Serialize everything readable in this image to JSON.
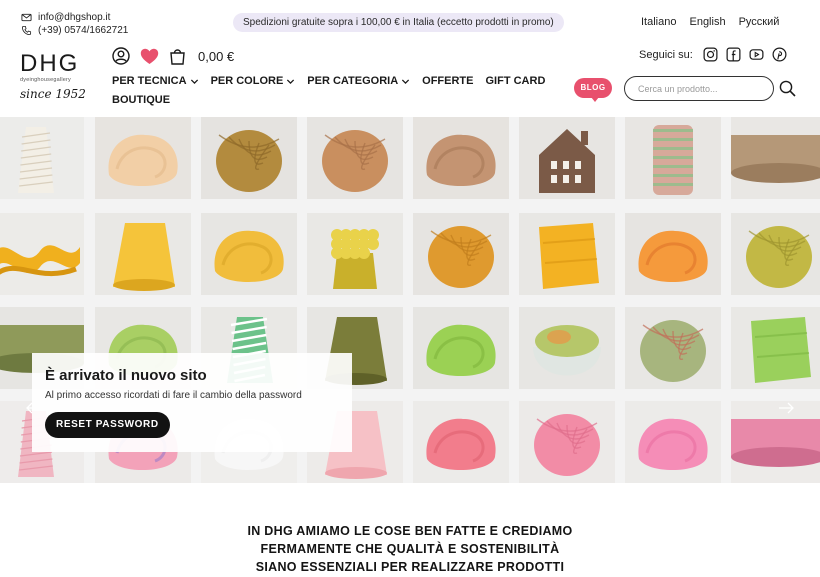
{
  "topbar": {
    "email": "info@dhgshop.it",
    "phone": "(+39) 0574/1662721",
    "promo": "Spedizioni gratuite sopra i 100,00 € in Italia (eccetto prodotti in promo)",
    "languages": [
      "Italiano",
      "English",
      "Русский"
    ]
  },
  "header": {
    "logo_main": "DHG",
    "logo_sub": "dyeinghousegallery",
    "logo_since": "since 1952",
    "cart_total": "0,00 €",
    "social_label": "Seguici su:",
    "search_placeholder": "Cerca un prodotto...",
    "blog_label": "BLOG",
    "social_icons": [
      "instagram-icon",
      "facebook-icon",
      "youtube-icon",
      "pinterest-icon"
    ]
  },
  "nav": {
    "items": [
      {
        "label": "PER TECNICA",
        "dropdown": true
      },
      {
        "label": "PER COLORE",
        "dropdown": true
      },
      {
        "label": "PER CATEGORIA",
        "dropdown": true
      },
      {
        "label": "OFFERTE",
        "dropdown": false
      },
      {
        "label": "GIFT CARD",
        "dropdown": false
      },
      {
        "label": "BOUTIQUE",
        "dropdown": false
      }
    ]
  },
  "hero": {
    "tiles": [
      {
        "bg": "#ececea",
        "color": "#f3efe6",
        "accent": "#d9cfbd",
        "shape": "cone"
      },
      {
        "bg": "#e7e4e0",
        "color": "#f2cfa6",
        "accent": "#e3b98b",
        "shape": "fleece"
      },
      {
        "bg": "#e5e3e0",
        "color": "#b38b3e",
        "accent": "#8e6a2a",
        "shape": "ball"
      },
      {
        "bg": "#e6e4e1",
        "color": "#c98f5f",
        "accent": "#a87148",
        "shape": "ball"
      },
      {
        "bg": "#e6e3df",
        "color": "#c49472",
        "accent": "#a77856",
        "shape": "fleece"
      },
      {
        "bg": "#e7e5e2",
        "color": "#7b5a47",
        "accent": "#5f4434",
        "shape": "house"
      },
      {
        "bg": "#e8e6e3",
        "color": "#d7a99a",
        "accent": "#8fbf8a",
        "shape": "spool"
      },
      {
        "bg": "#e9e7e4",
        "color": "#b59878",
        "accent": "#9b7d5e",
        "shape": "roll"
      },
      {
        "bg": "#ecebe8",
        "color": "#f0b01e",
        "accent": "#d79510",
        "shape": "ribbon"
      },
      {
        "bg": "#e9e8e5",
        "color": "#f5c43a",
        "accent": "#dca61f",
        "shape": "felt"
      },
      {
        "bg": "#e7e6e3",
        "color": "#f1bd3c",
        "accent": "#d9a325",
        "shape": "fleece"
      },
      {
        "bg": "#e9e8e5",
        "color": "#e9d24a",
        "accent": "#c9b02b",
        "shape": "boucle"
      },
      {
        "bg": "#e6e4e1",
        "color": "#df9a2f",
        "accent": "#c07d1d",
        "shape": "ball"
      },
      {
        "bg": "#e8e7e4",
        "color": "#f3b223",
        "accent": "#d99512",
        "shape": "cloth"
      },
      {
        "bg": "#e6e4e1",
        "color": "#f59a3c",
        "accent": "#e0742a",
        "shape": "fleece"
      },
      {
        "bg": "#e7e6e3",
        "color": "#c2b845",
        "accent": "#9e942f",
        "shape": "ball"
      },
      {
        "bg": "#e6e5e2",
        "color": "#8f9a5a",
        "accent": "#6e7a40",
        "shape": "roll"
      },
      {
        "bg": "#e8e7e4",
        "color": "#a9cf64",
        "accent": "#8bb44c",
        "shape": "fleece"
      },
      {
        "bg": "#e9e8e5",
        "color": "#6cc28a",
        "accent": "#ffffff",
        "shape": "stripe"
      },
      {
        "bg": "#e7e6e3",
        "color": "#7b7d3a",
        "accent": "#5f6128",
        "shape": "felt"
      },
      {
        "bg": "#e6e5e2",
        "color": "#9bd154",
        "accent": "#7fb43c",
        "shape": "fleece"
      },
      {
        "bg": "#e7e6e3",
        "color": "#b6c76a",
        "accent": "#e59a4a",
        "shape": "bowl"
      },
      {
        "bg": "#e8e7e4",
        "color": "#a7b57e",
        "accent": "#c26f5a",
        "shape": "ball"
      },
      {
        "bg": "#e9e8e5",
        "color": "#9ad05c",
        "accent": "#7cb640",
        "shape": "cloth"
      },
      {
        "bg": "#eeeceb",
        "color": "#f0b6c2",
        "accent": "#e89aab",
        "shape": "cone"
      },
      {
        "bg": "#eceae8",
        "color": "#f3a2b9",
        "accent": "#9a79c9",
        "shape": "fleece"
      },
      {
        "bg": "#efeeec",
        "color": "#f7f7f7",
        "accent": "#eaeaea",
        "shape": "fleece"
      },
      {
        "bg": "#edebe9",
        "color": "#f6c1c6",
        "accent": "#efa6ae",
        "shape": "felt"
      },
      {
        "bg": "#ecebe9",
        "color": "#f27d8c",
        "accent": "#e06070",
        "shape": "fleece"
      },
      {
        "bg": "#eceae8",
        "color": "#f28ca6",
        "accent": "#e06d8b",
        "shape": "ball"
      },
      {
        "bg": "#ecebe9",
        "color": "#f58db7",
        "accent": "#e96ea0",
        "shape": "fleece"
      },
      {
        "bg": "#edebe9",
        "color": "#e889a9",
        "accent": "#cf6d8f",
        "shape": "roll"
      },
      {
        "bg": "#eceae8",
        "color": "#f2a7c0",
        "accent": "#e58aa6",
        "shape": "fleece"
      }
    ],
    "notice_title": "È arrivato il nuovo sito",
    "notice_text": "Al primo accesso ricordati di fare il cambio della password",
    "notice_button": "RESET PASSWORD"
  },
  "tagline": {
    "lines": [
      "IN DHG AMIAMO LE COSE BEN FATTE E CREDIAMO",
      "FERMAMENTE CHE QUALITÀ E SOSTENIBILITÀ",
      "SIANO ESSENZIALI PER REALIZZARE PRODOTTI"
    ]
  },
  "colors": {
    "accent_pink": "#e8506d",
    "heart": "#e8506d",
    "promo_bg": "#ece8f6",
    "button_dark": "#121212"
  }
}
